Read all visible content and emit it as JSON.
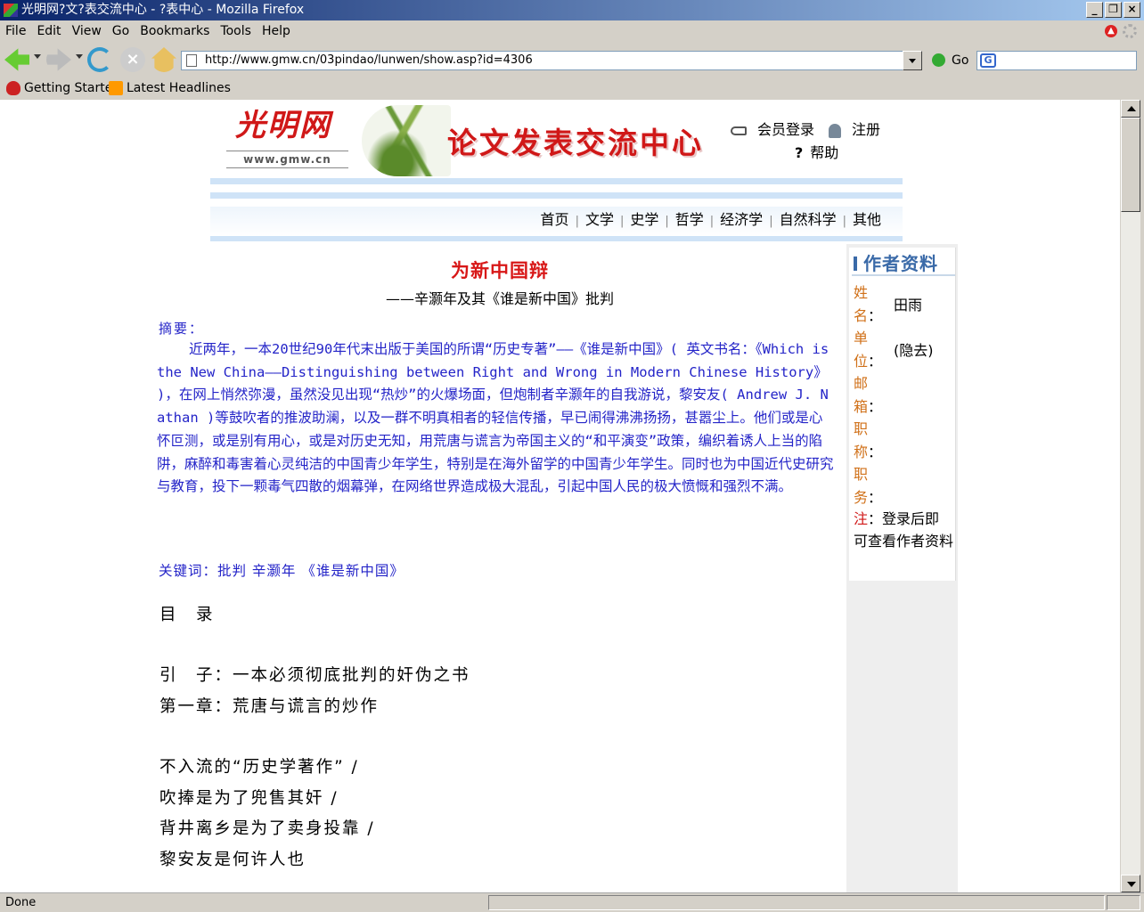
{
  "window": {
    "title": "光明网?文?表交流中心 - ?表中心 - Mozilla Firefox"
  },
  "menu": [
    "File",
    "Edit",
    "View",
    "Go",
    "Bookmarks",
    "Tools",
    "Help"
  ],
  "toolbar": {
    "url": "http://www.gmw.cn/03pindao/lunwen/show.asp?id=4306",
    "go_label": "Go"
  },
  "bookmarks": [
    "Getting Started",
    "Latest Headlines"
  ],
  "status": "Done",
  "site": {
    "logo_text": "光明网",
    "logo_url": "www.gmw.cn",
    "title": "论文发表交流中心",
    "login": "会员登录",
    "register": "注册",
    "help": "帮助",
    "nav": [
      "首页",
      "文学",
      "史学",
      "哲学",
      "经济学",
      "自然科学",
      "其他"
    ]
  },
  "article": {
    "title": "为新中国辩",
    "subtitle": "——辛灏年及其《谁是新中国》批判",
    "abstract_label": "摘要：",
    "abstract": "近两年，一本20世纪90年代末出版于美国的所谓“历史专著”——《谁是新中国》( 英文书名：《Which is the New China——Distinguishing between Right and Wrong in Modern Chinese History》 )，在网上悄然弥漫，虽然没见出现“热炒”的火爆场面，但炮制者辛灏年的自我游说，黎安友( Andrew J. Nathan )等鼓吹者的推波助澜，以及一群不明真相者的轻信传播，早已闹得沸沸扬扬，甚嚣尘上。他们或是心怀叵测，或是别有用心，或是对历史无知，用荒唐与谎言为帝国主义的“和平演变”政策，编织着诱人上当的陷阱，麻醉和毒害着心灵纯洁的中国青少年学生，特别是在海外留学的中国青少年学生。同时也为中国近代史研究与教育，投下一颗毒气四散的烟幕弹，在网络世界造成极大混乱，引起中国人民的极大愤慨和强烈不满。",
    "keywords": "关键词：批判 辛灏年 《谁是新中国》",
    "toc_heading": "目　录",
    "toc": [
      "引　子：一本必须彻底批判的奸伪之书",
      "第一章：荒唐与谎言的炒作",
      "不入流的“历史学著作” /",
      "吹捧是为了兜售其奸 /",
      "背井离乡是为了卖身投靠 /",
      "黎安友是何许人也"
    ]
  },
  "author": {
    "heading": "作者资料",
    "name_label": "姓名",
    "name": "田雨",
    "unit_label": "单位",
    "unit": "(隐去)",
    "email_label": "邮箱",
    "title_label": "职称",
    "position_label": "职务",
    "note_label": "注",
    "note": "：登录后即可查看作者资料"
  }
}
